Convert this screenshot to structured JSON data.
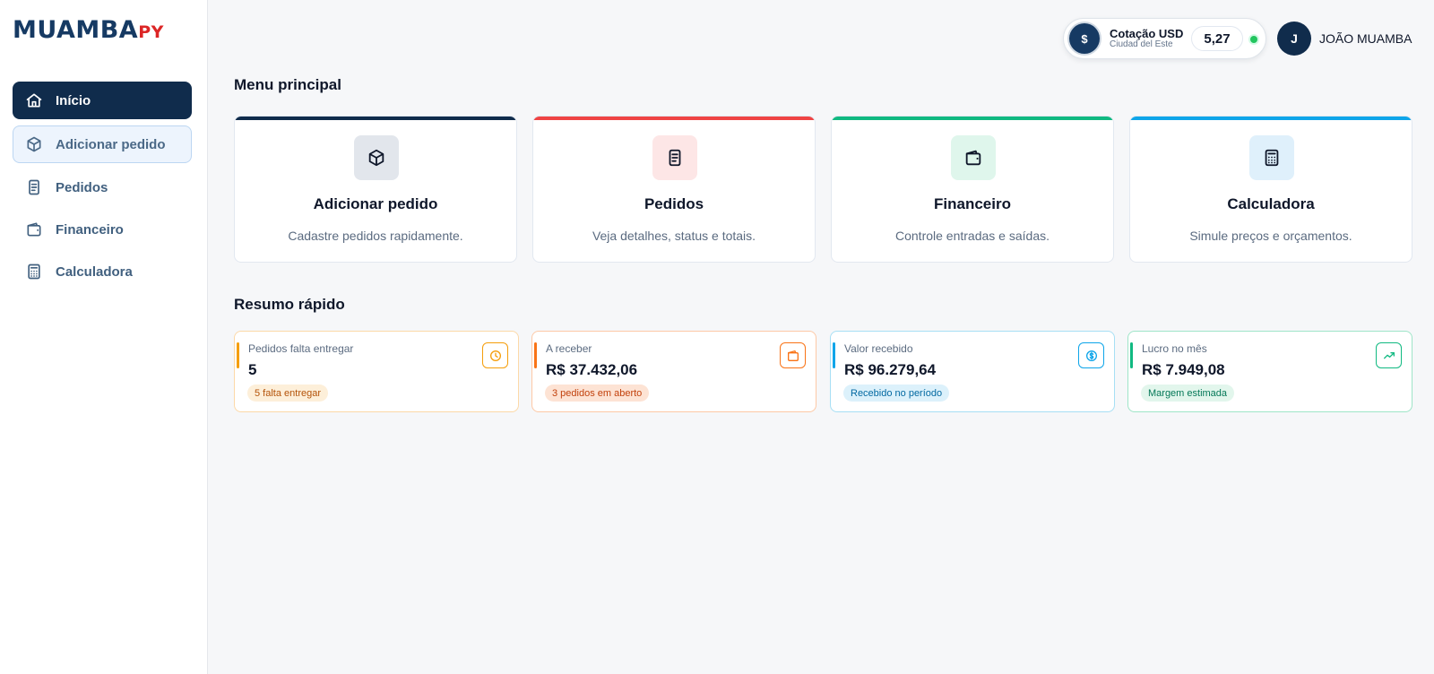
{
  "app": {
    "logo_main": "MUAMBA",
    "logo_accent": "PY"
  },
  "sidebar": {
    "items": [
      {
        "label": "Início",
        "icon": "home-icon"
      },
      {
        "label": "Adicionar pedido",
        "icon": "box-icon"
      },
      {
        "label": "Pedidos",
        "icon": "document-icon"
      },
      {
        "label": "Financeiro",
        "icon": "wallet-icon"
      },
      {
        "label": "Calculadora",
        "icon": "calculator-icon"
      }
    ]
  },
  "header": {
    "rate_symbol": "$",
    "rate_title": "Cotação USD",
    "rate_subtitle": "Ciudad del Este",
    "rate_value": "5,27",
    "user_initial": "J",
    "user_name": "JOÃO MUAMBA"
  },
  "main_menu": {
    "title": "Menu principal",
    "cards": [
      {
        "title": "Adicionar pedido",
        "description": "Cadastre pedidos rapidamente.",
        "icon": "box-icon",
        "accent": "#102c4c",
        "icon_bg": "#e2e6ec"
      },
      {
        "title": "Pedidos",
        "description": "Veja detalhes, status e totais.",
        "icon": "document-icon",
        "accent": "#ef4444",
        "icon_bg": "#fde6e6"
      },
      {
        "title": "Financeiro",
        "description": "Controle entradas e saídas.",
        "icon": "wallet-icon",
        "accent": "#10b981",
        "icon_bg": "#dff6ec"
      },
      {
        "title": "Calculadora",
        "description": "Simule preços e orçamentos.",
        "icon": "calculator-icon",
        "accent": "#0ea5e9",
        "icon_bg": "#dff0fb"
      }
    ]
  },
  "summary": {
    "title": "Resumo rápido",
    "cards": [
      {
        "label": "Pedidos falta entregar",
        "value": "5",
        "badge": "5 falta entregar",
        "icon": "clock-icon",
        "color": "#f59e0b",
        "border": "#fcd9a8",
        "badge_bg": "#fdefd9",
        "badge_text": "#b45309"
      },
      {
        "label": "A receber",
        "value": "R$ 37.432,06",
        "badge": "3 pedidos em aberto",
        "icon": "wallet-icon",
        "color": "#f97316",
        "border": "#fdc9a6",
        "badge_bg": "#fde3d4",
        "badge_text": "#c2410c"
      },
      {
        "label": "Valor recebido",
        "value": "R$ 96.279,64",
        "badge": "Recebido no período",
        "icon": "dollar-circle-icon",
        "color": "#0ea5e9",
        "border": "#a7dff4",
        "badge_bg": "#dcf1fb",
        "badge_text": "#0369a1"
      },
      {
        "label": "Lucro no mês",
        "value": "R$ 7.949,08",
        "badge": "Margem estimada",
        "icon": "trend-up-icon",
        "color": "#10b981",
        "border": "#9fe5c8",
        "badge_bg": "#e2f6ec",
        "badge_text": "#047857"
      }
    ]
  }
}
